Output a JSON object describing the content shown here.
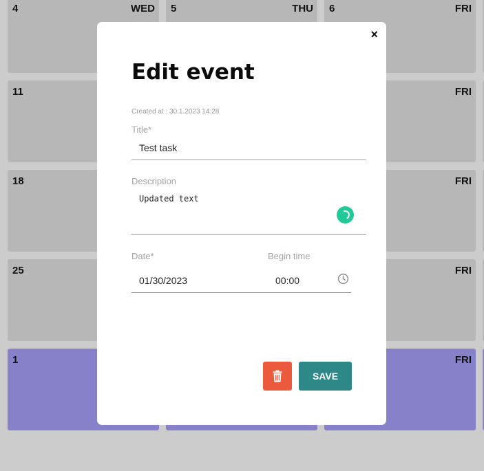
{
  "calendar": {
    "rows": [
      {
        "num": "4",
        "day": "WED",
        "num2": "5",
        "day2": "THU",
        "num3": "6",
        "day3": "FRI"
      },
      {
        "num": "11",
        "day3": "FRI"
      },
      {
        "num": "18",
        "day3": "FRI"
      },
      {
        "num": "25",
        "day3": "FRI"
      },
      {
        "num": "1",
        "day3": "FRI"
      }
    ]
  },
  "modal": {
    "close_label": "×",
    "title": "Edit event",
    "created_at": "Created at : 30.1.2023 14:28",
    "title_field": {
      "label": "Title*",
      "value": "Test task"
    },
    "description_field": {
      "label": "Description",
      "value": "Updated text"
    },
    "date_field": {
      "label": "Date*",
      "value": "01/30/2023"
    },
    "time_field": {
      "label": "Begin time",
      "value": "00:00"
    },
    "delete_icon": "trash-icon",
    "save_label": "SAVE"
  },
  "colors": {
    "delete": "#ec5a3d",
    "save": "#2e8888",
    "spinner": "#20c997",
    "event_cell": "#8681c8"
  }
}
